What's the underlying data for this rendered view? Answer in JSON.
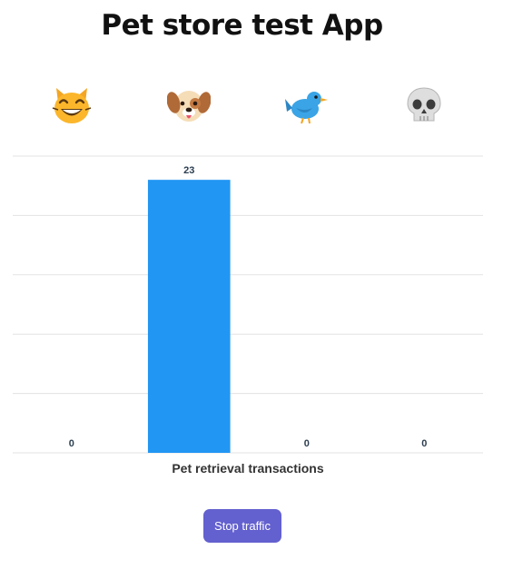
{
  "app": {
    "title": "Pet store test App"
  },
  "pets": [
    {
      "icon": "cat-grinning-icon",
      "glyph": "😸"
    },
    {
      "icon": "dog-face-icon",
      "glyph": "🐶"
    },
    {
      "icon": "bird-icon",
      "glyph": "🐦"
    },
    {
      "icon": "skull-icon",
      "glyph": "💀"
    }
  ],
  "chart_data": {
    "type": "bar",
    "categories": [
      "cat",
      "dog",
      "bird",
      "skull"
    ],
    "values": [
      0,
      23,
      0,
      0
    ],
    "xlabel": "Pet retrieval transactions",
    "ylim": [
      0,
      25
    ],
    "grid": true,
    "bar_color": "#2196f3",
    "data_label_color": "#2c3e50"
  },
  "controls": {
    "stop_traffic_label": "Stop traffic"
  },
  "colors": {
    "button_bg": "#6360cf",
    "button_text": "#ffffff"
  }
}
